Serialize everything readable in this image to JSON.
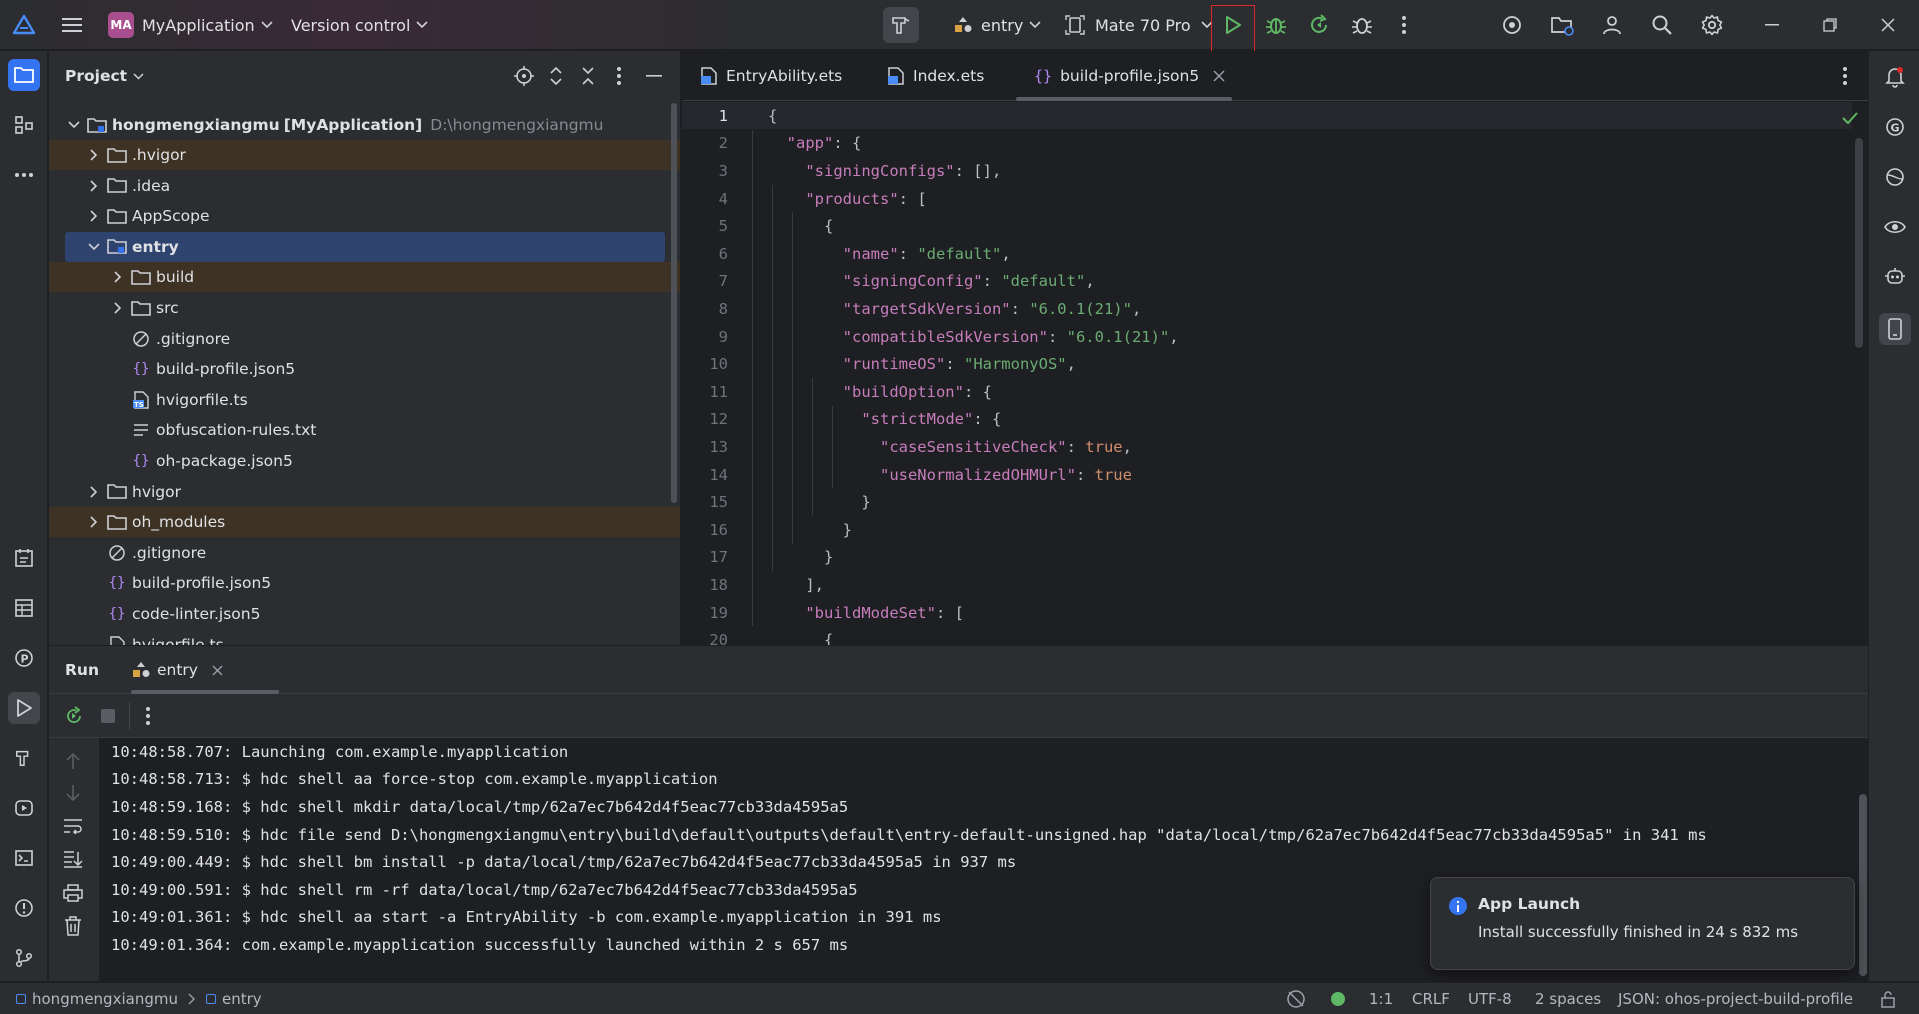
{
  "titlebar": {
    "project_initials": "MA",
    "project_name": "MyApplication",
    "version_control": "Version control",
    "run_config": "entry",
    "device": "Mate 70 Pro"
  },
  "colors": {
    "accent": "#3574f0",
    "run_green": "#5fb865",
    "highlight_border": "#d9292b",
    "selection": "#2e436e",
    "folder_hl": "#3d3223"
  },
  "project_panel": {
    "title": "Project",
    "root_name": "hongmengxiangmu",
    "root_module": "[MyApplication]",
    "root_path": "D:\\hongmengxiangmu",
    "items": [
      {
        "label": ".hvigor",
        "icon": "folder-icon"
      },
      {
        "label": ".idea",
        "icon": "folder-icon"
      },
      {
        "label": "AppScope",
        "icon": "folder-icon"
      },
      {
        "label": "entry",
        "icon": "module-folder-icon"
      },
      {
        "label": "build",
        "icon": "folder-icon"
      },
      {
        "label": "src",
        "icon": "folder-icon"
      },
      {
        "label": ".gitignore",
        "icon": "ignore-file-icon"
      },
      {
        "label": "build-profile.json5",
        "icon": "json-file-icon"
      },
      {
        "label": "hvigorfile.ts",
        "icon": "ts-file-icon"
      },
      {
        "label": "obfuscation-rules.txt",
        "icon": "text-file-icon"
      },
      {
        "label": "oh-package.json5",
        "icon": "json-file-icon"
      },
      {
        "label": "hvigor",
        "icon": "folder-icon"
      },
      {
        "label": "oh_modules",
        "icon": "folder-icon"
      },
      {
        "label": ".gitignore",
        "icon": "ignore-file-icon"
      },
      {
        "label": "build-profile.json5",
        "icon": "json-file-icon"
      },
      {
        "label": "code-linter.json5",
        "icon": "json-file-icon"
      },
      {
        "label": "hvigorfile.ts",
        "icon": "ts-file-icon"
      }
    ]
  },
  "editor": {
    "tabs": [
      {
        "label": "EntryAbility.ets"
      },
      {
        "label": "Index.ets"
      },
      {
        "label": "build-profile.json5",
        "active": true
      }
    ],
    "line_numbers": [
      "1",
      "2",
      "3",
      "4",
      "5",
      "6",
      "7",
      "8",
      "9",
      "10",
      "11",
      "12",
      "13",
      "14",
      "15",
      "16",
      "17",
      "18",
      "19",
      "20"
    ]
  },
  "run_panel": {
    "title": "Run",
    "tab": "entry",
    "console": [
      "10:48:58.707: Launching com.example.myapplication",
      "10:48:58.713: $ hdc shell aa force-stop com.example.myapplication",
      "10:48:59.168: $ hdc shell mkdir data/local/tmp/62a7ec7b642d4f5eac77cb33da4595a5",
      "10:48:59.510: $ hdc file send D:\\hongmengxiangmu\\entry\\build\\default\\outputs\\default\\entry-default-unsigned.hap \"data/local/tmp/62a7ec7b642d4f5eac77cb33da4595a5\" in 341 ms",
      "10:49:00.449: $ hdc shell bm install -p data/local/tmp/62a7ec7b642d4f5eac77cb33da4595a5 in 937 ms",
      "10:49:00.591: $ hdc shell rm -rf data/local/tmp/62a7ec7b642d4f5eac77cb33da4595a5",
      "10:49:01.361: $ hdc shell aa start -a EntryAbility -b com.example.myapplication in 391 ms",
      "10:49:01.364: com.example.myapplication successfully launched within 2 s 657 ms"
    ]
  },
  "notification": {
    "title": "App Launch",
    "message": "Install successfully finished in 24 s 832 ms"
  },
  "statusbar": {
    "breadcrumb_root": "hongmengxiangmu",
    "breadcrumb_module": "entry",
    "position": "1:1",
    "line_ending": "CRLF",
    "encoding": "UTF-8",
    "indent": "2 spaces",
    "schema": "JSON: ohos-project-build-profile"
  }
}
